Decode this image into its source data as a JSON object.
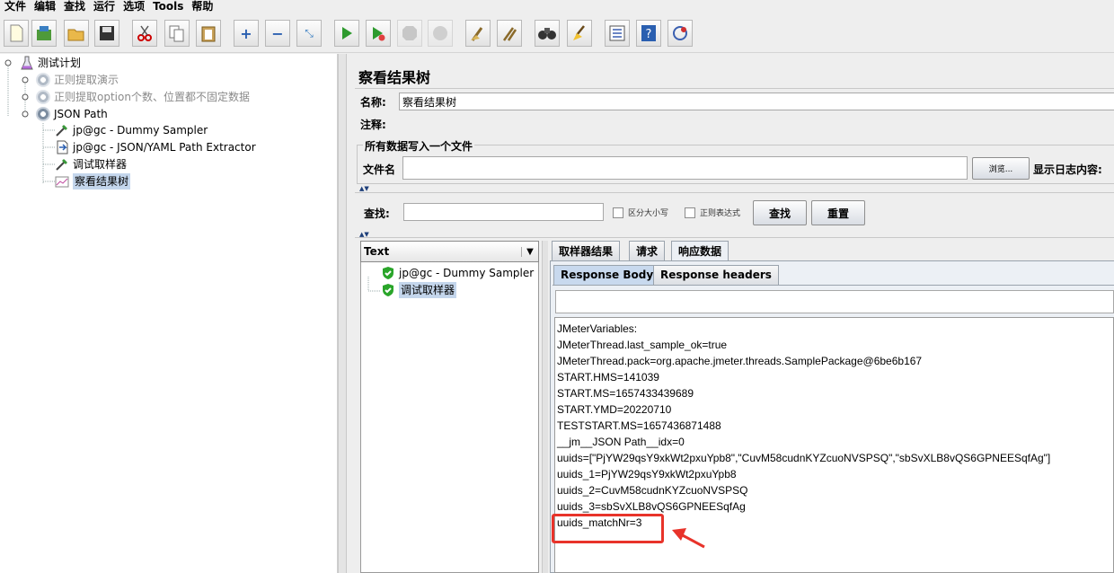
{
  "menu": [
    "文件",
    "编辑",
    "查找",
    "运行",
    "选项",
    "Tools",
    "帮助"
  ],
  "toolbar_icons": [
    "new-icon",
    "templates-icon",
    "open-icon",
    "save-icon",
    "cut-icon",
    "copy-icon",
    "paste-icon",
    "expand-icon",
    "collapse-icon",
    "toggle-icon",
    "start-icon",
    "start-no-pause-icon",
    "stop-icon",
    "shutdown-icon",
    "clear-icon",
    "clear-all-icon",
    "search-icon",
    "reset-search-icon",
    "function-helper-icon",
    "help-icon",
    "remote-icon"
  ],
  "tree": {
    "root": "测试计划",
    "items": [
      {
        "label": "正则提取演示",
        "disabled": true
      },
      {
        "label": "正则提取option个数、位置都不固定数据",
        "disabled": true
      },
      {
        "label": "JSON Path",
        "disabled": false
      }
    ],
    "children": [
      {
        "label": "jp@gc - Dummy Sampler"
      },
      {
        "label": "jp@gc - JSON/YAML Path Extractor"
      },
      {
        "label": "调试取样器"
      },
      {
        "label": "察看结果树"
      }
    ]
  },
  "panel": {
    "title": "察看结果树",
    "name_label": "名称:",
    "name_value": "察看结果树",
    "comment_label": "注释:",
    "comment_value": "",
    "file_section_title": "所有数据写入一个文件",
    "filename_label": "文件名",
    "filename_value": "",
    "browse_label": "浏览...",
    "log_label": "显示日志内容:"
  },
  "search": {
    "label": "查找:",
    "value": "",
    "case_label": "区分大小写",
    "regex_label": "正则表达式",
    "find_button": "查找",
    "reset_button": "重置"
  },
  "renderer": {
    "selected": "Text"
  },
  "results_tree": [
    {
      "label": "jp@gc - Dummy Sampler",
      "selected": false
    },
    {
      "label": "调试取样器",
      "selected": true
    }
  ],
  "tabs": [
    "取样器结果",
    "请求",
    "响应数据"
  ],
  "active_tab": "响应数据",
  "subtabs": [
    "Response Body",
    "Response headers"
  ],
  "active_subtab": "Response Body",
  "response_lines": [
    "JMeterVariables:",
    "JMeterThread.last_sample_ok=true",
    "JMeterThread.pack=org.apache.jmeter.threads.SamplePackage@6be6b167",
    "START.HMS=141039",
    "START.MS=1657433439689",
    "START.YMD=20220710",
    "TESTSTART.MS=1657436871488",
    "__jm__JSON Path__idx=0",
    "uuids=[\"PjYW29qsY9xkWt2pxuYpb8\",\"CuvM58cudnKYZcuoNVSPSQ\",\"sbSvXLB8vQS6GPNEESqfAg\"]",
    "uuids_1=PjYW29qsY9xkWt2pxuYpb8",
    "uuids_2=CuvM58cudnKYZcuoNVSPSQ",
    "uuids_3=sbSvXLB8vQS6GPNEESqfAg",
    "uuids_matchNr=3"
  ],
  "colors": {
    "annotation": "#e8332a",
    "selection": "#c4d6ec",
    "check": "#2aa52a"
  }
}
